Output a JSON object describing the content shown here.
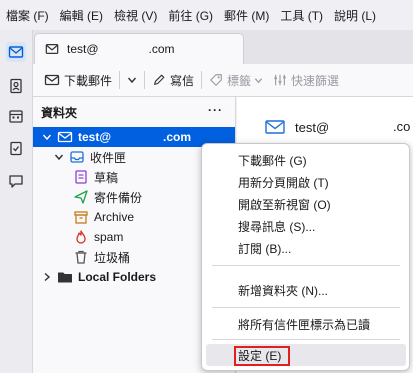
{
  "menubar": [
    "檔案 (F)",
    "編輯 (E)",
    "檢視 (V)",
    "前往 (G)",
    "郵件 (M)",
    "工具 (T)",
    "說明 (L)"
  ],
  "tab": {
    "title": "test@",
    "domain": ".com"
  },
  "toolbar": {
    "get_messages": "下載郵件",
    "write": "寫信",
    "tag": "標籤",
    "quick_filter": "快速篩選"
  },
  "folder_pane": {
    "header": "資料夾",
    "more": "···",
    "account": {
      "name": "test@",
      "domain": ".com"
    },
    "folders": [
      {
        "label": "收件匣",
        "icon": "inbox-icon"
      },
      {
        "label": "草稿",
        "icon": "drafts-icon"
      },
      {
        "label": "寄件備份",
        "icon": "sent-icon"
      },
      {
        "label": "Archive",
        "icon": "archive-icon"
      },
      {
        "label": "spam",
        "icon": "spam-icon"
      },
      {
        "label": "垃圾桶",
        "icon": "trash-icon"
      }
    ],
    "local_folders": "Local Folders"
  },
  "message_area": {
    "account": "test@",
    "domain": ".co"
  },
  "context_menu": {
    "items": [
      "下載郵件 (G)",
      "用新分頁開啟 (T)",
      "開啟至新視窗 (O)",
      "搜尋訊息 (S)...",
      "訂閱 (B)...",
      "新增資料夾 (N)...",
      "將所有信件匣標示為已讀",
      "設定 (E)"
    ]
  },
  "colors": {
    "accent": "#0060df",
    "highlight_box": "#e02020"
  }
}
